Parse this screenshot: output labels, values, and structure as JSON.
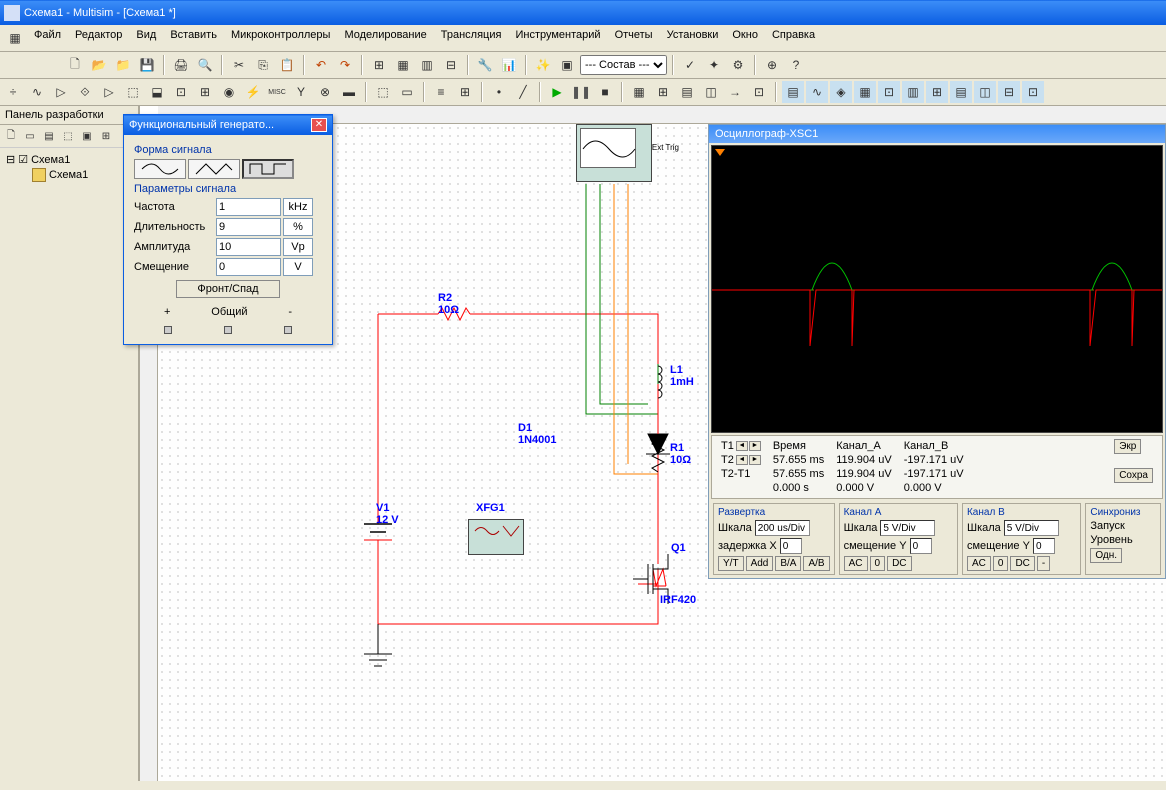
{
  "app": {
    "title": "Схема1 - Multisim - [Схема1 *]"
  },
  "menu": [
    "Файл",
    "Редактор",
    "Вид",
    "Вставить",
    "Микроконтроллеры",
    "Моделирование",
    "Трансляция",
    "Инструментарий",
    "Отчеты",
    "Установки",
    "Окно",
    "Справка"
  ],
  "toolbar_select": "--- Состав ---",
  "side": {
    "title": "Панель разработки",
    "tree_root": "Схема1",
    "tree_child": "Схема1"
  },
  "components": {
    "R2": {
      "name": "R2",
      "value": "10Ω"
    },
    "R1": {
      "name": "R1",
      "value": "10Ω"
    },
    "L1": {
      "name": "L1",
      "value": "1mH"
    },
    "D1": {
      "name": "D1",
      "model": "1N4001"
    },
    "V1": {
      "name": "V1",
      "value": "12 V"
    },
    "Q1": {
      "name": "Q1",
      "model": "IRF420"
    },
    "XFG1": {
      "name": "XFG1"
    },
    "scope_ext": "Ext Trig"
  },
  "funcgen": {
    "title": "Функциональный генерато...",
    "section_wave": "Форма сигнала",
    "section_params": "Параметры сигнала",
    "freq_label": "Частота",
    "freq_val": "1",
    "freq_unit": "kHz",
    "duty_label": "Длительность",
    "duty_val": "9",
    "duty_unit": "%",
    "amp_label": "Амплитуда",
    "amp_val": "10",
    "amp_unit": "Vp",
    "off_label": "Смещение",
    "off_val": "0",
    "off_unit": "V",
    "edge_btn": "Фронт/Спад",
    "common": "Общий",
    "term_plus": "+",
    "term_minus": "-"
  },
  "scope": {
    "title": "Осциллограф-XSC1",
    "readout": {
      "labels": {
        "t1": "T1",
        "t2": "T2",
        "diff": "T2-T1"
      },
      "headers": {
        "time": "Время",
        "chA": "Канал_A",
        "chB": "Канал_B"
      },
      "t1_time": "57.655 ms",
      "t1_a": "119.904 uV",
      "t1_b": "-197.171 uV",
      "t2_time": "57.655 ms",
      "t2_a": "119.904 uV",
      "t2_b": "-197.171 uV",
      "diff_time": "0.000 s",
      "diff_a": "0.000 V",
      "diff_b": "0.000 V"
    },
    "btn_exp": "Экр",
    "btn_save": "Сохра",
    "timebase": {
      "title": "Развертка",
      "scale_label": "Шкала",
      "scale_val": "200 us/Div",
      "delay_label": "задержка X",
      "delay_val": "0",
      "btns": [
        "Y/T",
        "Add",
        "B/A",
        "A/B"
      ]
    },
    "chA": {
      "title": "Канал A",
      "scale_label": "Шкала",
      "scale_val": "5 V/Div",
      "ypos_label": "смещение Y",
      "ypos_val": "0",
      "btns": [
        "AC",
        "0",
        "DC"
      ]
    },
    "chB": {
      "title": "Канал B",
      "scale_label": "Шкала",
      "scale_val": "5 V/Div",
      "ypos_label": "смещение Y",
      "ypos_val": "0",
      "btns": [
        "AC",
        "0",
        "DC",
        "-"
      ]
    },
    "trigger": {
      "title": "Синхрониз",
      "mode_label": "Запуск",
      "level_label": "Уровень",
      "btns": [
        "Одн."
      ]
    }
  },
  "chart_data": {
    "type": "line",
    "title": "Осциллограф-XSC1",
    "xlabel": "Время",
    "x_scale": "200 us/Div",
    "series": [
      {
        "name": "Канал A",
        "y_scale": "5 V/Div",
        "color": "#00c000"
      },
      {
        "name": "Канал B",
        "y_scale": "5 V/Div",
        "color": "#ff0000"
      }
    ],
    "cursors": {
      "T1": {
        "time": "57.655 ms",
        "chA": "119.904 uV",
        "chB": "-197.171 uV"
      },
      "T2": {
        "time": "57.655 ms",
        "chA": "119.904 uV",
        "chB": "-197.171 uV"
      },
      "T2-T1": {
        "time": "0.000 s",
        "chA": "0.000 V",
        "chB": "0.000 V"
      }
    }
  }
}
